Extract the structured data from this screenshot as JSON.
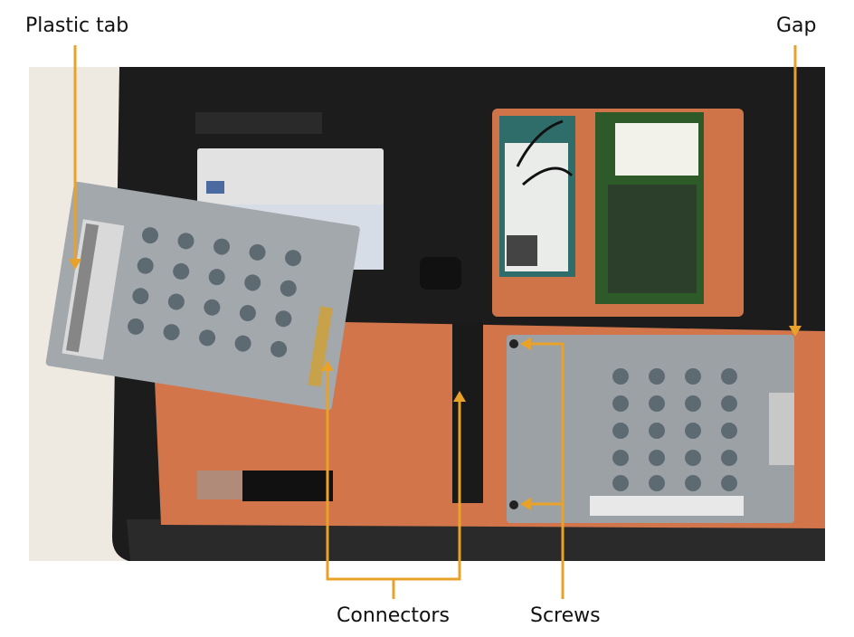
{
  "labels": {
    "plastic_tab": "Plastic tab",
    "gap": "Gap",
    "connectors": "Connectors",
    "screws": "Screws"
  },
  "colors": {
    "callout": "#e8a22a",
    "chassis": "#1f1f1f",
    "bay_orange": "#d8784a",
    "drive_metal": "#9ea3a8"
  }
}
